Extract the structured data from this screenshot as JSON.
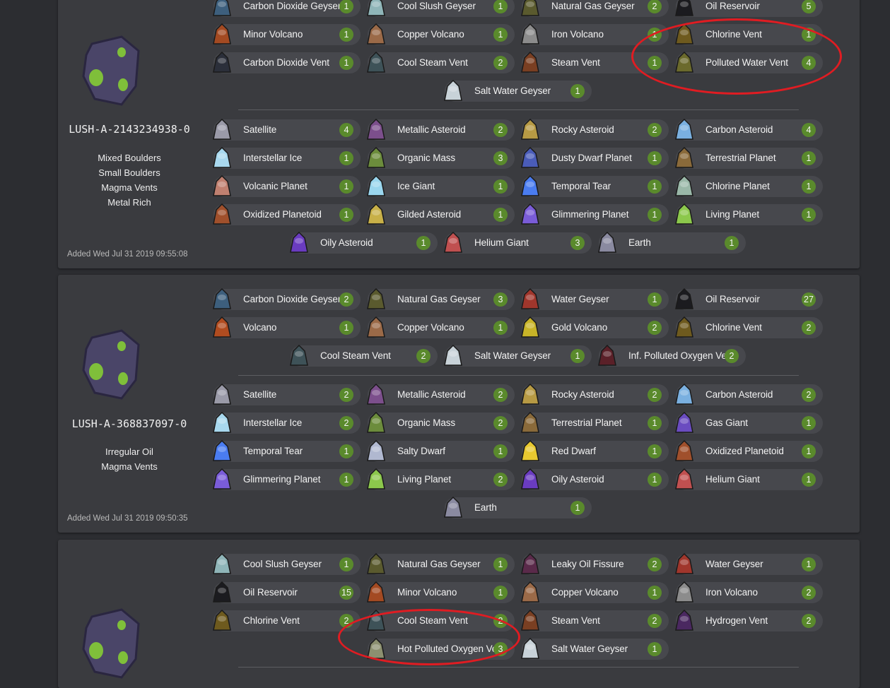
{
  "accent": {
    "count_badge": "#5a8a2c",
    "annotation_ring": "#e01c22"
  },
  "seeds": [
    {
      "name": "LUSH-A-2143234938-0",
      "traits": [
        "Mixed Boulders",
        "Small Boulders",
        "Magma Vents",
        "Metal Rich"
      ],
      "added": "Added Wed Jul 31 2019 09:55:08",
      "geysers": [
        {
          "name": "Carbon Dioxide Geyser",
          "count": "1",
          "color": "#3d5f7d"
        },
        {
          "name": "Cool Slush Geyser",
          "count": "1",
          "color": "#8fb5b8"
        },
        {
          "name": "Natural Gas Geyser",
          "count": "2",
          "color": "#5a5a2e"
        },
        {
          "name": "Oil Reservoir",
          "count": "5",
          "color": "#1b1b1f"
        },
        {
          "name": "Minor Volcano",
          "count": "1",
          "color": "#a34a22"
        },
        {
          "name": "Copper Volcano",
          "count": "1",
          "color": "#9b6a48"
        },
        {
          "name": "Iron Volcano",
          "count": "1",
          "color": "#8c8c8c"
        },
        {
          "name": "Chlorine Vent",
          "count": "1",
          "color": "#6e5a1e"
        },
        {
          "name": "Carbon Dioxide Vent",
          "count": "1",
          "color": "#2b2f3a"
        },
        {
          "name": "Cool Steam Vent",
          "count": "2",
          "color": "#3e5258"
        },
        {
          "name": "Steam Vent",
          "count": "1",
          "color": "#7a3f22"
        },
        {
          "name": "Polluted Water Vent",
          "count": "4",
          "color": "#6b6a2c"
        },
        {
          "name": "Salt Water Geyser",
          "count": "1",
          "color": "#c8d2d8"
        }
      ],
      "points": [
        {
          "name": "Satellite",
          "count": "4",
          "color": "#9a9aa8"
        },
        {
          "name": "Metallic Asteroid",
          "count": "2",
          "color": "#7c4f8c"
        },
        {
          "name": "Rocky Asteroid",
          "count": "2",
          "color": "#b79a44"
        },
        {
          "name": "Carbon Asteroid",
          "count": "4",
          "color": "#7ab0e0"
        },
        {
          "name": "Interstellar Ice",
          "count": "1",
          "color": "#a8d8ee"
        },
        {
          "name": "Organic Mass",
          "count": "3",
          "color": "#6c8c3c"
        },
        {
          "name": "Dusty Dwarf Planet",
          "count": "1",
          "color": "#4a5cb8"
        },
        {
          "name": "Terrestrial Planet",
          "count": "1",
          "color": "#8a6a3a"
        },
        {
          "name": "Volcanic Planet",
          "count": "1",
          "color": "#c08070"
        },
        {
          "name": "Ice Giant",
          "count": "1",
          "color": "#9ad6ee"
        },
        {
          "name": "Temporal Tear",
          "count": "1",
          "color": "#4a7cf0"
        },
        {
          "name": "Chlorine Planet",
          "count": "1",
          "color": "#9ab8a8"
        },
        {
          "name": "Oxidized Planetoid",
          "count": "1",
          "color": "#a0502c"
        },
        {
          "name": "Gilded Asteroid",
          "count": "1",
          "color": "#c8b048"
        },
        {
          "name": "Glimmering Planet",
          "count": "1",
          "color": "#7a5cd8"
        },
        {
          "name": "Living Planet",
          "count": "1",
          "color": "#8cc84c"
        },
        {
          "name": "Oily Asteroid",
          "count": "1",
          "color": "#6a3cc0"
        },
        {
          "name": "Helium Giant",
          "count": "3",
          "color": "#c05050"
        },
        {
          "name": "Earth",
          "count": "1",
          "color": "#8a8aa0"
        }
      ]
    },
    {
      "name": "LUSH-A-368837097-0",
      "traits": [
        "Irregular Oil",
        "Magma Vents"
      ],
      "added": "Added Wed Jul 31 2019 09:50:35",
      "geysers": [
        {
          "name": "Carbon Dioxide Geyser",
          "count": "2",
          "color": "#3d5f7d"
        },
        {
          "name": "Natural Gas Geyser",
          "count": "3",
          "color": "#5a5a2e"
        },
        {
          "name": "Water Geyser",
          "count": "1",
          "color": "#a0362c"
        },
        {
          "name": "Oil Reservoir",
          "count": "27",
          "color": "#1b1b1f"
        },
        {
          "name": "Volcano",
          "count": "1",
          "color": "#b04c20"
        },
        {
          "name": "Copper Volcano",
          "count": "1",
          "color": "#9b6a48"
        },
        {
          "name": "Gold Volcano",
          "count": "2",
          "color": "#c8b428"
        },
        {
          "name": "Chlorine Vent",
          "count": "2",
          "color": "#6e5a1e"
        },
        {
          "name": "Cool Steam Vent",
          "count": "2",
          "color": "#3e5258"
        },
        {
          "name": "Salt Water Geyser",
          "count": "1",
          "color": "#c8d2d8"
        },
        {
          "name": "Inf. Polluted Oxygen Vent",
          "count": "2",
          "color": "#5a2028"
        }
      ],
      "points": [
        {
          "name": "Satellite",
          "count": "2",
          "color": "#9a9aa8"
        },
        {
          "name": "Metallic Asteroid",
          "count": "2",
          "color": "#7c4f8c"
        },
        {
          "name": "Rocky Asteroid",
          "count": "2",
          "color": "#b79a44"
        },
        {
          "name": "Carbon Asteroid",
          "count": "2",
          "color": "#7ab0e0"
        },
        {
          "name": "Interstellar Ice",
          "count": "2",
          "color": "#a8d8ee"
        },
        {
          "name": "Organic Mass",
          "count": "2",
          "color": "#6c8c3c"
        },
        {
          "name": "Terrestrial Planet",
          "count": "1",
          "color": "#8a6a3a"
        },
        {
          "name": "Gas Giant",
          "count": "1",
          "color": "#6a4cc0"
        },
        {
          "name": "Temporal Tear",
          "count": "1",
          "color": "#4a7cf0"
        },
        {
          "name": "Salty Dwarf",
          "count": "1",
          "color": "#b0b8d0"
        },
        {
          "name": "Red Dwarf",
          "count": "1",
          "color": "#e8c830"
        },
        {
          "name": "Oxidized Planetoid",
          "count": "1",
          "color": "#a0502c"
        },
        {
          "name": "Glimmering Planet",
          "count": "1",
          "color": "#7a5cd8"
        },
        {
          "name": "Living Planet",
          "count": "2",
          "color": "#8cc84c"
        },
        {
          "name": "Oily Asteroid",
          "count": "1",
          "color": "#6a3cc0"
        },
        {
          "name": "Helium Giant",
          "count": "1",
          "color": "#c05050"
        },
        {
          "name": "Earth",
          "count": "1",
          "color": "#8a8aa0"
        }
      ]
    },
    {
      "name": "",
      "traits": [],
      "added": "",
      "geysers": [
        {
          "name": "Cool Slush Geyser",
          "count": "1",
          "color": "#8fb5b8"
        },
        {
          "name": "Natural Gas Geyser",
          "count": "1",
          "color": "#5a5a2e"
        },
        {
          "name": "Leaky Oil Fissure",
          "count": "2",
          "color": "#5a2a4a"
        },
        {
          "name": "Water Geyser",
          "count": "1",
          "color": "#a0362c"
        },
        {
          "name": "Oil Reservoir",
          "count": "15",
          "color": "#1b1b1f"
        },
        {
          "name": "Minor Volcano",
          "count": "1",
          "color": "#a34a22"
        },
        {
          "name": "Copper Volcano",
          "count": "1",
          "color": "#9b6a48"
        },
        {
          "name": "Iron Volcano",
          "count": "2",
          "color": "#8c8c8c"
        },
        {
          "name": "Chlorine Vent",
          "count": "2",
          "color": "#6e5a1e"
        },
        {
          "name": "Cool Steam Vent",
          "count": "2",
          "color": "#3e5258"
        },
        {
          "name": "Steam Vent",
          "count": "2",
          "color": "#7a3f22"
        },
        {
          "name": "Hydrogen Vent",
          "count": "2",
          "color": "#4a2860"
        },
        {
          "name": "Hot Polluted Oxygen Vent",
          "count": "3",
          "color": "#8c9070"
        },
        {
          "name": "Salt Water Geyser",
          "count": "1",
          "color": "#c8d2d8"
        }
      ],
      "points": []
    }
  ]
}
